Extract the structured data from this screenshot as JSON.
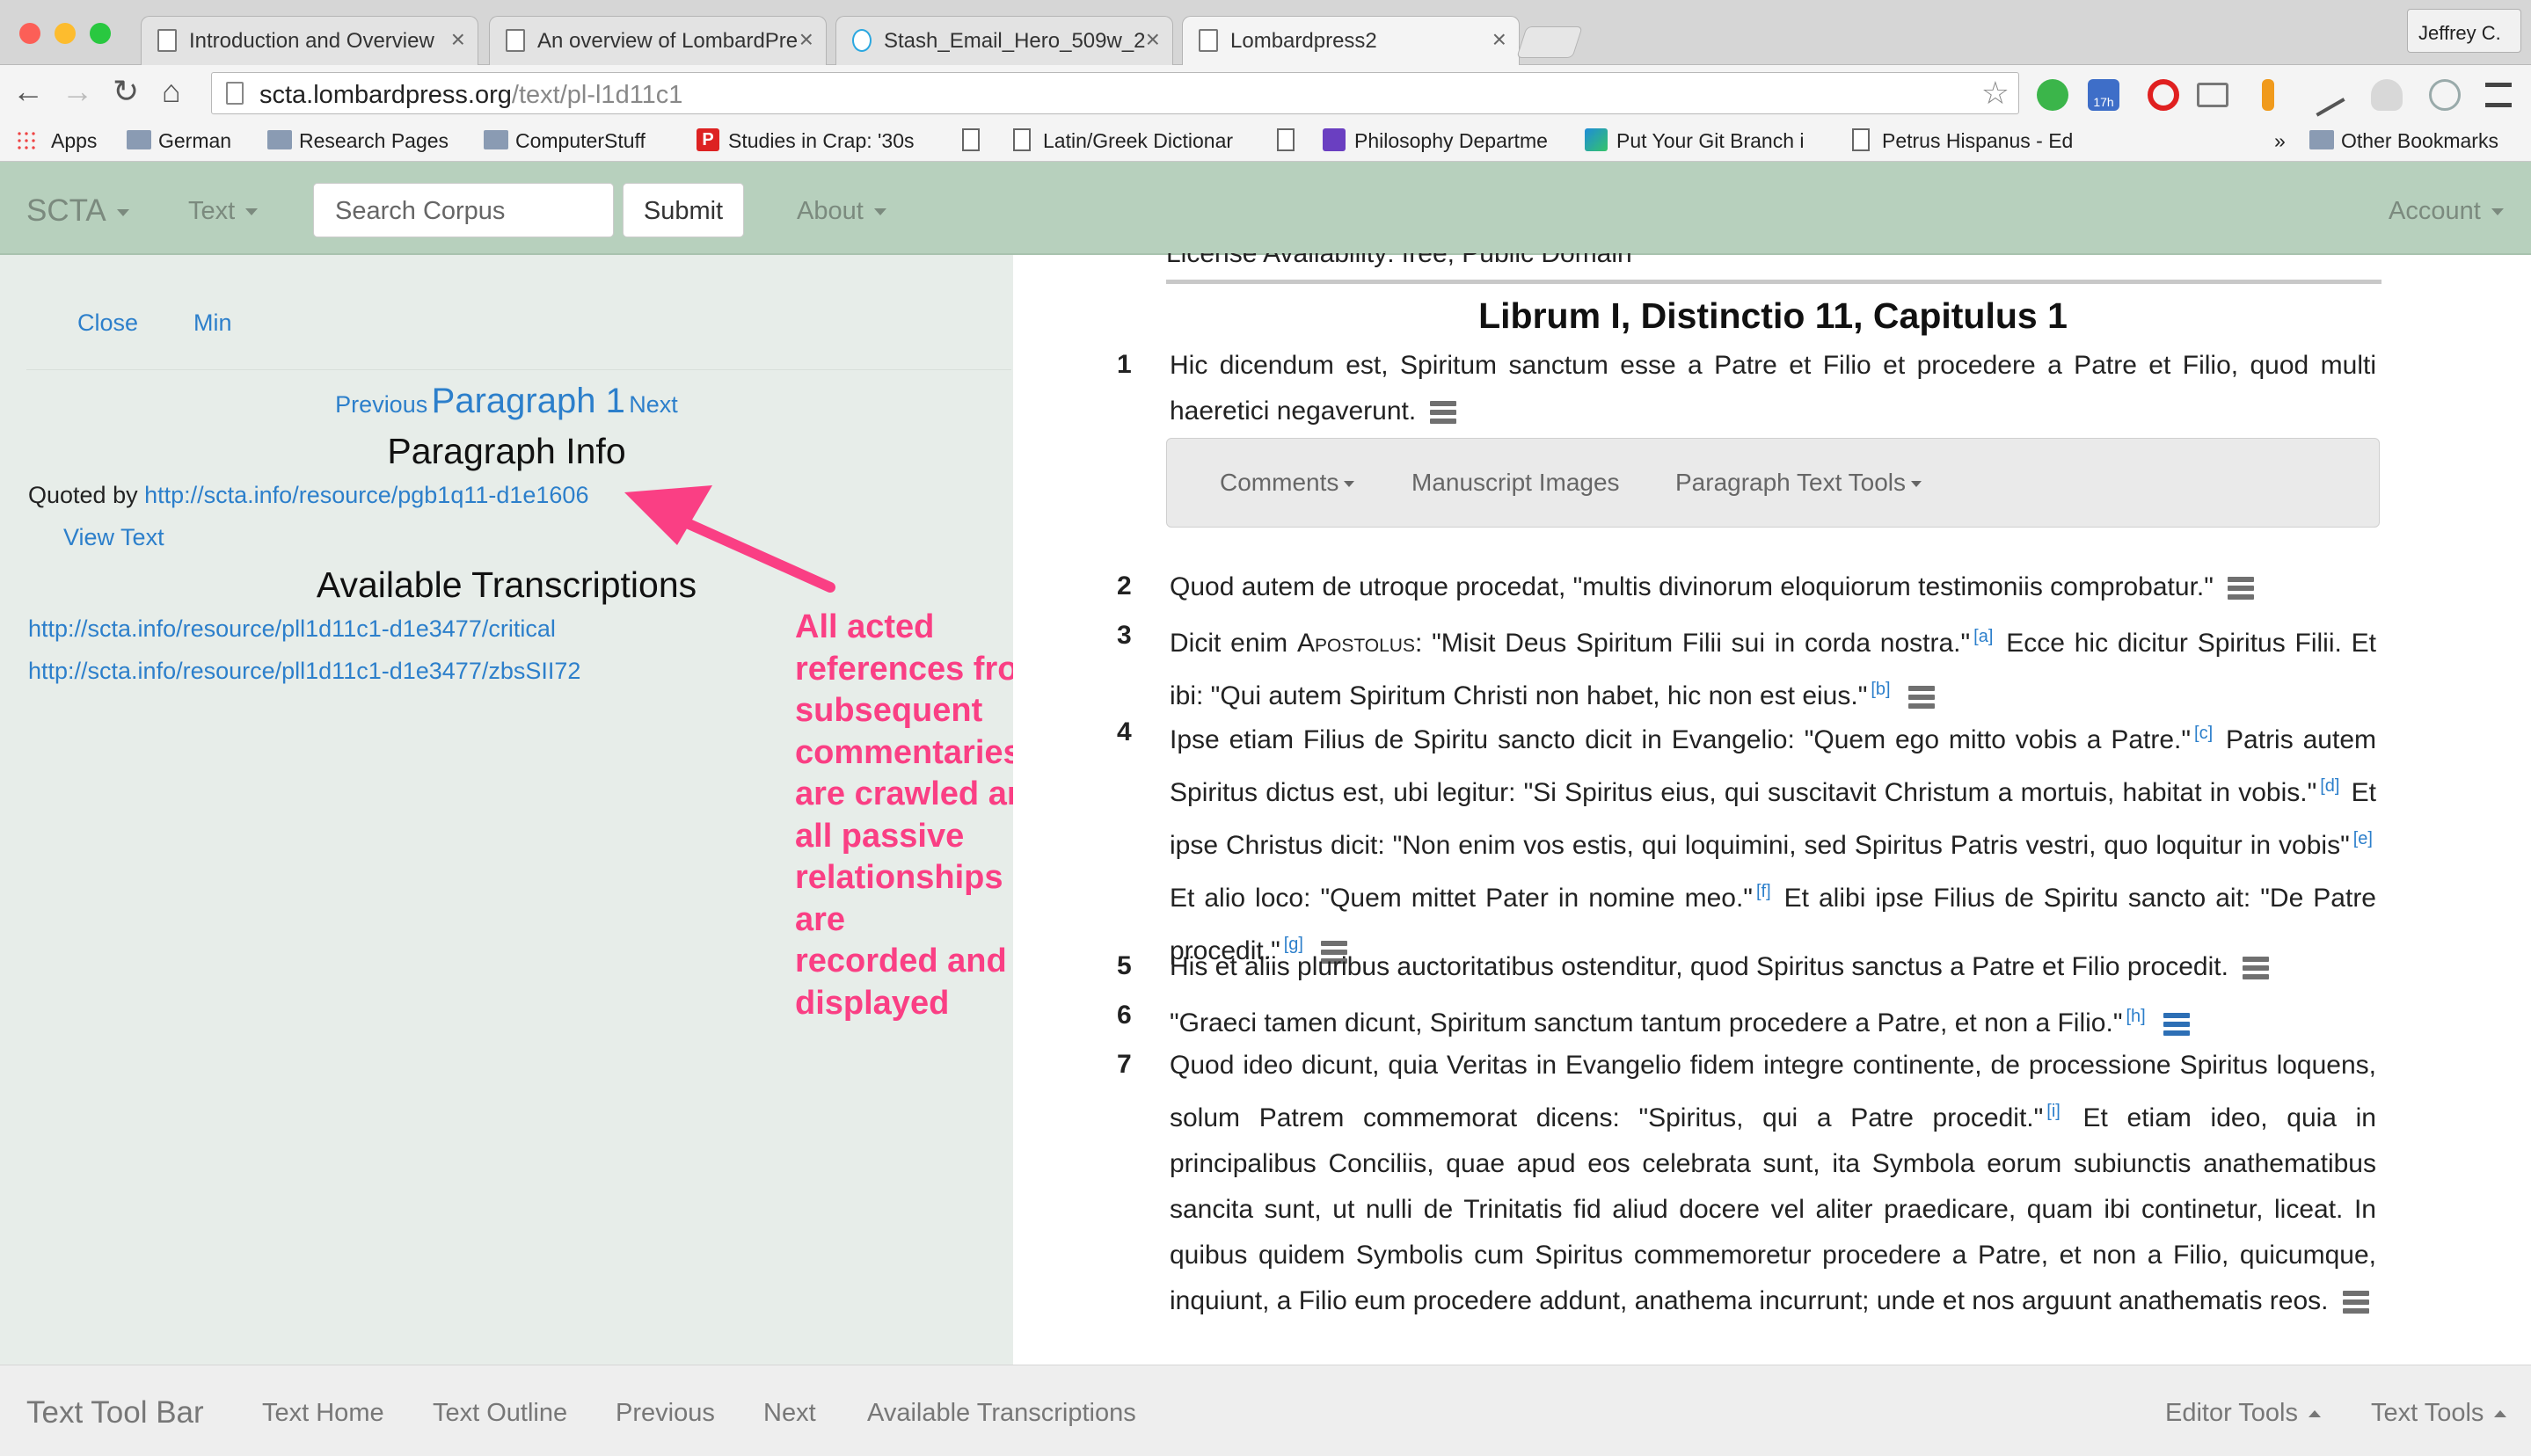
{
  "browser": {
    "tabs": [
      {
        "title": "Introduction and Overview"
      },
      {
        "title": "An overview of LombardPre"
      },
      {
        "title": "Stash_Email_Hero_509w_2"
      },
      {
        "title": "Lombardpress2"
      }
    ],
    "profile": "Jeffrey C.",
    "url_host": "scta.lombardpress.org",
    "url_path": "/text/pl-l1d11c1",
    "calendar_badge": "17h",
    "bookmarks": [
      {
        "label": "Apps"
      },
      {
        "label": "German"
      },
      {
        "label": "Research Pages"
      },
      {
        "label": "ComputerStuff"
      },
      {
        "label": "Studies in Crap: '30s"
      },
      {
        "label": "Latin/Greek Dictionar"
      },
      {
        "label": "Philosophy Departme"
      },
      {
        "label": "Put Your Git Branch i"
      },
      {
        "label": "Petrus Hispanus - Ed"
      },
      {
        "label": "»"
      },
      {
        "label": "Other Bookmarks"
      }
    ]
  },
  "appnav": {
    "brand": "SCTA",
    "text_menu": "Text",
    "search_placeholder": "Search Corpus",
    "submit": "Submit",
    "about": "About",
    "account": "Account"
  },
  "left_panel": {
    "close": "Close",
    "min": "Min",
    "previous": "Previous",
    "paragraph_label": "Paragraph 1",
    "next": "Next",
    "info_heading": "Paragraph Info",
    "quoted_by_label": "Quoted by",
    "quoted_by_link": "http://scta.info/resource/pgb1q11-d1e1606",
    "view_text": "View Text",
    "transcriptions_heading": "Available Transcriptions",
    "transcriptions": [
      "http://scta.info/resource/pll1d11c1-d1e3477/critical",
      "http://scta.info/resource/pll1d11c1-d1e3477/zbsSII72"
    ]
  },
  "annotation": {
    "lines": [
      "All acted",
      "references from",
      "subsequent",
      "commentaries",
      "are crawled and",
      "all passive",
      "relationships are",
      "recorded and",
      "displayed"
    ],
    "color": "#fa3f84"
  },
  "main": {
    "cut_line": "License Availability: free, Public Domain",
    "heading": "Librum I, Distinctio 11, Capitulus 1",
    "paragraph_tools": [
      "Comments",
      "Manuscript Images",
      "Paragraph Text Tools"
    ],
    "paragraphs": [
      {
        "num": "1",
        "segments": [
          "Hic dicendum est, Spiritum sanctum esse a Patre et Filio et procedere a Patre et Filio, quod multi haeretici negaverunt."
        ]
      },
      {
        "num": "2",
        "segments": [
          "Quod autem de utroque procedat, \"multis divinorum eloquiorum testimoniis comprobatur.\""
        ]
      },
      {
        "num": "3",
        "segments": [
          "Dicit enim ",
          "Apostolus",
          ": \"Misit Deus Spiritum Filii sui in corda nostra.\"",
          "[a]",
          " Ecce hic dicitur Spiritus Filii. Et ibi: \"Qui autem Spiritum Christi non habet, hic non est eius.\"",
          "[b]"
        ]
      },
      {
        "num": "4",
        "segments": [
          "Ipse etiam Filius de Spiritu sancto dicit in Evangelio: \"Quem ego mitto vobis a Patre.\"",
          "[c]",
          " Patris autem Spiritus dictus est, ubi legitur: \"Si Spiritus eius, qui suscitavit Christum a mortuis, habitat in vobis.\"",
          "[d]",
          " Et ipse Christus dicit: \"Non enim vos estis, qui loquimini, sed Spiritus Patris vestri, quo loquitur in vobis\"",
          "[e]",
          " Et alio loco: \"Quem mittet Pater in nomine meo.\"",
          "[f]",
          " Et alibi ipse Filius de Spiritu sancto ait: \"De Patre procedit.\"",
          "[g]"
        ]
      },
      {
        "num": "5",
        "segments": [
          "His et aliis pluribus auctoritatibus ostenditur, quod Spiritus sanctus a Patre et Filio procedit."
        ]
      },
      {
        "num": "6",
        "segments": [
          "\"Graeci tamen dicunt, Spiritum sanctum tantum procedere a Patre, et non a Filio.\"",
          "[h]"
        ]
      },
      {
        "num": "7",
        "segments": [
          "Quod ideo dicunt, quia Veritas in Evangelio fidem integre continente, de processione Spiritus loquens, solum Patrem commemorat dicens: \"Spiritus, qui a Patre procedit.\"",
          "[i]",
          " Et etiam ideo, quia in principalibus Conciliis, quae apud eos celebrata sunt, ita Symbola eorum subiunctis anathematibus sancita sunt, ut nulli de Trinitatis fid aliud docere vel aliter praedicare, quam ibi continetur, liceat. In quibus quidem Symbolis cum Spiritus commemoretur procedere a Patre, et non a Filio, quicumque, inquiunt, a Filio eum procedere addunt, anathema incurrunt; unde et nos arguunt anathematis reos."
        ]
      }
    ]
  },
  "bottombar": {
    "title": "Text Tool Bar",
    "links": [
      "Text Home",
      "Text Outline",
      "Previous",
      "Next",
      "Available Transcriptions"
    ],
    "editor_tools": "Editor Tools",
    "text_tools": "Text Tools"
  }
}
